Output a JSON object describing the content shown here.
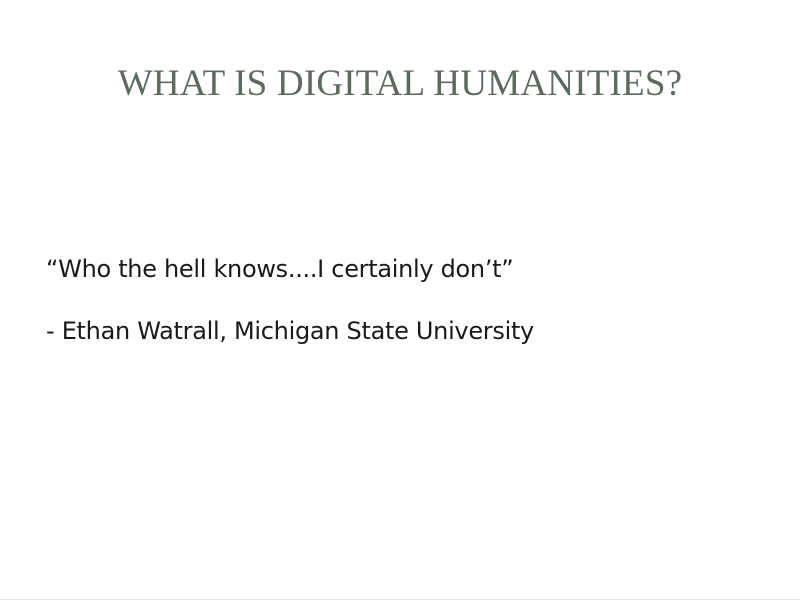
{
  "slide": {
    "title": "WHAT IS DIGITAL HUMANITIES?",
    "quote": "“Who the hell knows....I certainly don’t”",
    "attribution": "- Ethan Watrall, Michigan State University"
  },
  "colors": {
    "title": "#5d6b5e",
    "body_text": "#1a1a1a",
    "background": "#ffffff"
  }
}
